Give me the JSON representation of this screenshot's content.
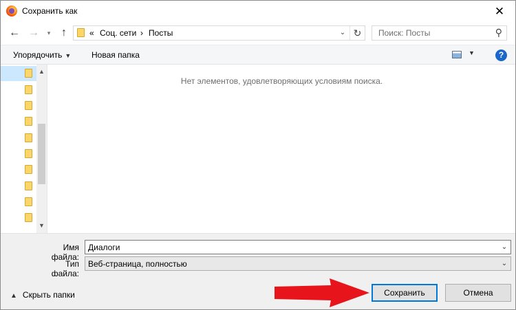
{
  "window": {
    "title": "Сохранить как",
    "close_glyph": "✕"
  },
  "nav": {
    "back_glyph": "←",
    "forward_glyph": "→",
    "recent_glyph": "▾",
    "up_glyph": "↑"
  },
  "address": {
    "overflow": "«",
    "separator": "›",
    "crumbs": [
      "Соц. сети",
      "Посты"
    ],
    "dropdown_glyph": "⌄",
    "refresh_glyph": "↻"
  },
  "search": {
    "placeholder": "Поиск: Посты",
    "icon_glyph": "⚲"
  },
  "toolbar": {
    "organize_label": "Упорядочить",
    "new_folder_label": "Новая папка",
    "help_label": "?"
  },
  "content": {
    "empty_message": "Нет элементов, удовлетворяющих условиям поиска."
  },
  "form": {
    "filename_label": "Имя файла:",
    "filename_value": "Диалоги",
    "filetype_label": "Тип файла:",
    "filetype_value": "Веб-страница, полностью"
  },
  "footer": {
    "hide_folders_label": "Скрыть папки",
    "save_label": "Сохранить",
    "cancel_label": "Отмена"
  },
  "colors": {
    "accent": "#0078d7",
    "selection": "#cce8ff",
    "folder": "#fbd66a",
    "annotation_arrow": "#e8141b"
  },
  "icons": {
    "app": "firefox-icon",
    "folder": "folder-icon",
    "view": "view-options-icon",
    "help": "help-icon"
  }
}
